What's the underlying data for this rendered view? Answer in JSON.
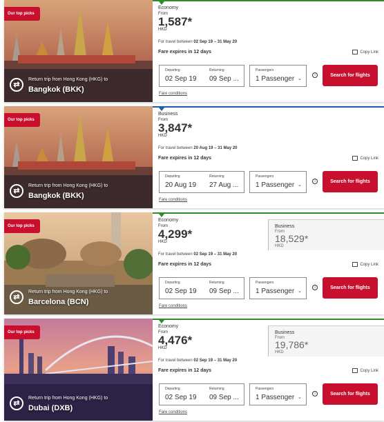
{
  "colors": {
    "brand_red": "#c8102e",
    "economy_bar": "#2e8b2e",
    "business_bar": "#1f5fa8"
  },
  "icons": {
    "return_trip": "return-arrows-icon",
    "copy": "copy-link-icon",
    "info": "info-icon",
    "dropdown": "chevron-down-icon"
  },
  "cards": [
    {
      "badge": "Our top picks",
      "route": "Return trip from Hong Kong (HKG) to",
      "destination": "Bangkok (BKK)",
      "cabin": "Economy",
      "from": "From",
      "price": "1,587*",
      "currency": "HKD",
      "travel_prefix": "For travel between",
      "travel_dates": "02 Sep 19 – 31 May 20",
      "expires": "Fare expires in 12 days",
      "copy_link": "Copy Link",
      "departing_label": "Departing",
      "returning_label": "Returning",
      "departing": "02 Sep 19",
      "returning": "09 Sep ...",
      "passengers_label": "Passengers",
      "passengers": "1 Passenger",
      "search": "Search for flights",
      "conditions": "Fare conditions"
    },
    {
      "badge": "Our top picks",
      "route": "Return trip from Hong Kong (HKG) to",
      "destination": "Bangkok (BKK)",
      "cabin": "Business",
      "from": "From",
      "price": "3,847*",
      "currency": "HKD",
      "travel_prefix": "For travel between",
      "travel_dates": "20 Aug 19 – 31 May 20",
      "expires": "Fare expires in 12 days",
      "copy_link": "Copy Link",
      "departing_label": "Departing",
      "returning_label": "Returning",
      "departing": "20 Aug 19",
      "returning": "27 Aug ...",
      "passengers_label": "Passengers",
      "passengers": "1 Passenger",
      "search": "Search for flights",
      "conditions": "Fare conditions"
    },
    {
      "badge": "Our top picks",
      "route": "Return trip from Hong Kong (HKG) to",
      "destination": "Barcelona (BCN)",
      "cabin": "Economy",
      "from": "From",
      "price": "4,299*",
      "currency": "HKD",
      "alt_cabin": "Business",
      "alt_from": "From",
      "alt_price": "18,529*",
      "alt_currency": "HKD",
      "travel_prefix": "For travel between",
      "travel_dates": "02 Sep 19 – 31 May 20",
      "expires": "Fare expires in 12 days",
      "copy_link": "Copy Link",
      "departing_label": "Departing",
      "returning_label": "Returning",
      "departing": "02 Sep 19",
      "returning": "09 Sep ...",
      "passengers_label": "Passengers",
      "passengers": "1 Passenger",
      "search": "Search for flights",
      "conditions": "Fare conditions"
    },
    {
      "badge": "Our top picks",
      "route": "Return trip from Hong Kong (HKG) to",
      "destination": "Dubai (DXB)",
      "cabin": "Economy",
      "from": "From",
      "price": "4,476*",
      "currency": "HKD",
      "alt_cabin": "Business",
      "alt_from": "From",
      "alt_price": "19,786*",
      "alt_currency": "HKD",
      "travel_prefix": "For travel between",
      "travel_dates": "02 Sep 19 – 31 May 20",
      "expires": "Fare expires in 12 days",
      "copy_link": "Copy Link",
      "departing_label": "Departing",
      "returning_label": "Returning",
      "departing": "02 Sep 19",
      "returning": "09 Sep ...",
      "passengers_label": "Passengers",
      "passengers": "1 Passenger",
      "search": "Search for flights",
      "conditions": "Fare conditions"
    }
  ]
}
